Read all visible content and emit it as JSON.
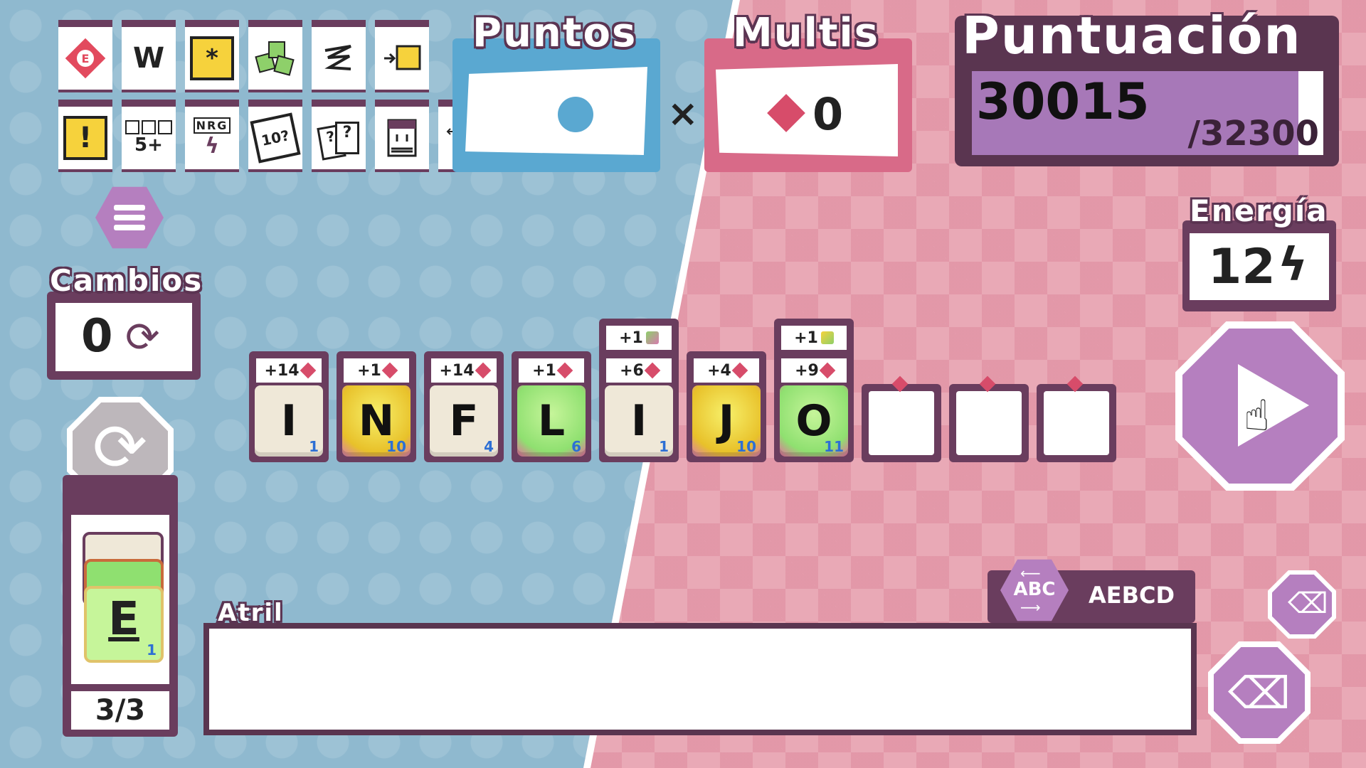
{
  "jokers": [
    {
      "name": "no-e-joker-icon"
    },
    {
      "name": "w-joker-icon",
      "text": "W"
    },
    {
      "name": "wildcard-joker-icon",
      "text": "*"
    },
    {
      "name": "stacked-a-joker-icon"
    },
    {
      "name": "scribble-arrow-joker-icon"
    },
    {
      "name": "arrow-square-joker-icon"
    },
    {
      "name": "exclamation-joker-icon",
      "text": "!"
    },
    {
      "name": "five-plus-joker-icon",
      "text": "5+"
    },
    {
      "name": "nrg-joker-icon",
      "text": "NRG"
    },
    {
      "name": "ten-question-joker-icon",
      "text": "10?"
    },
    {
      "name": "question-cards-joker-icon",
      "text": "?"
    },
    {
      "name": "deck-joker-icon"
    },
    {
      "name": "swap-arrows-joker-icon"
    },
    {
      "name": "question-cards-2-joker-icon",
      "text": "?"
    }
  ],
  "points": {
    "title": "Puntos"
  },
  "multis": {
    "title": "Multis",
    "value": "0"
  },
  "score": {
    "title": "Puntuación",
    "current": "30015",
    "target": "/32300",
    "fill_fraction": 0.93
  },
  "energy": {
    "title": "Energía",
    "value": "12"
  },
  "changes": {
    "title": "Cambios",
    "value": "0"
  },
  "deck": {
    "count": "3/3",
    "top_letter": "E",
    "top_value": "1"
  },
  "word_tiles": [
    {
      "letter": "I",
      "value": "1",
      "style": "plain",
      "tags": [
        "+14"
      ]
    },
    {
      "letter": "N",
      "value": "10",
      "style": "yellow",
      "tags": [
        "+1"
      ]
    },
    {
      "letter": "F",
      "value": "4",
      "style": "plain",
      "tags": [
        "+14"
      ]
    },
    {
      "letter": "L",
      "value": "6",
      "style": "green",
      "tags": [
        "+1"
      ]
    },
    {
      "letter": "I",
      "value": "1",
      "style": "plain",
      "tags": [
        "+1",
        "+6"
      ]
    },
    {
      "letter": "J",
      "value": "10",
      "style": "yellow",
      "tags": [
        "+4"
      ]
    },
    {
      "letter": "O",
      "value": "11",
      "style": "green",
      "tags": [
        "+1",
        "+9"
      ]
    }
  ],
  "empty_slots": 3,
  "sort": {
    "abc_label": "ABC",
    "order_label": "AEBCD"
  },
  "rack": {
    "title": "Atril"
  },
  "colors": {
    "blue_bg": "#8fb9cf",
    "pink_bg": "#e9a9b6",
    "dark_purple": "#5a3550",
    "accent_red": "#d74c6a"
  }
}
